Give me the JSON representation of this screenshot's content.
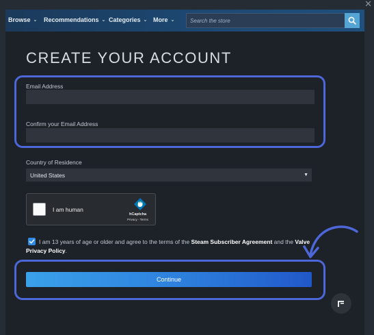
{
  "window": {
    "close_glyph": "✕"
  },
  "nav": {
    "items": [
      {
        "label": "Browse"
      },
      {
        "label": "Recommendations"
      },
      {
        "label": "Categories"
      },
      {
        "label": "More"
      }
    ],
    "caret": "⌄",
    "search": {
      "placeholder": "Search the store",
      "value": ""
    },
    "search_icon": "magnifier-icon"
  },
  "form": {
    "title": "CREATE YOUR ACCOUNT",
    "email_label": "Email Address",
    "email_value": "",
    "confirm_label": "Confirm your Email Address",
    "confirm_value": "",
    "country_label": "Country of Residence",
    "country_value": "United States",
    "captcha": {
      "label": "I am human",
      "brand": "hCaptcha",
      "links": "Privacy - Terms"
    },
    "agreement": {
      "checked": true,
      "text_1": "I am 13 years of age or older and agree to the terms of the ",
      "link_1": "Steam Subscriber Agreement",
      "text_2": " and the ",
      "link_2": "Valve Privacy Policy",
      "text_3": "."
    },
    "continue_label": "Continue"
  },
  "colors": {
    "accent": "#4d67d8",
    "button_start": "#3aa1ea",
    "button_end": "#2158c9",
    "panel": "#1d2128",
    "field": "#30353d"
  }
}
